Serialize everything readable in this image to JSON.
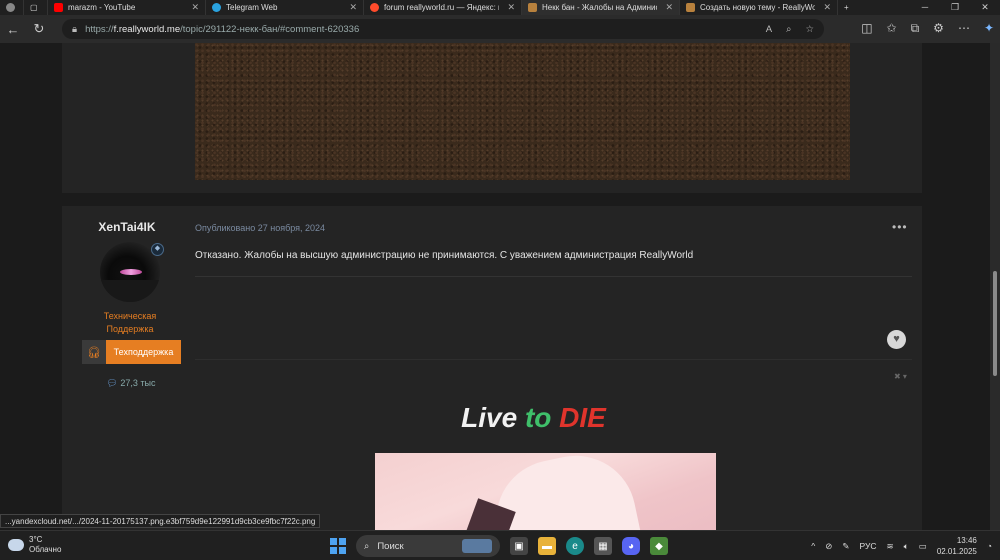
{
  "tabs": [
    {
      "label": "marazm - YouTube",
      "icon": "youtube-icon",
      "color": "#ff0000"
    },
    {
      "label": "Telegram Web",
      "icon": "telegram-icon",
      "color": "#2aa3e0"
    },
    {
      "label": "forum reallyworld.ru — Яндекс: н",
      "icon": "yandex-icon",
      "color": "#ff4b2b"
    },
    {
      "label": "Некк бан - Жалобы на Админис",
      "icon": "reallyworld-icon",
      "color": "#b8813d",
      "active": true
    },
    {
      "label": "Создать новую тему - ReallyWor",
      "icon": "reallyworld-icon",
      "color": "#b8813d"
    }
  ],
  "address": {
    "protocol": "https://",
    "host": "f.reallyworld.me",
    "path": "/topic/291122-некк-бан/#comment-620336"
  },
  "post": {
    "author": "XenTai4IK",
    "role_line1": "Техническая",
    "role_line2": "Поддержка",
    "support_label": "Техподдержка",
    "reputation": "27,3 тыс",
    "published_prefix": "Опубликовано",
    "published_date": "27 ноября, 2024",
    "body": "Отказано. Жалобы на высшую администрацию не принимаются. С уважением администрация ReallyWorld",
    "signature_title": {
      "w1": "Live",
      "w2": "to",
      "w3": "DIE"
    }
  },
  "status_url": "...yandexcloud.net/.../2024-11-20175137.png.e3bf759d9e122991d9cb3ce9fbc7f22c.png",
  "taskbar": {
    "weather_temp": "3°C",
    "weather_desc": "Облачно",
    "search_placeholder": "Поиск",
    "lang": "РУС",
    "time": "13:46",
    "date": "02.01.2025"
  }
}
